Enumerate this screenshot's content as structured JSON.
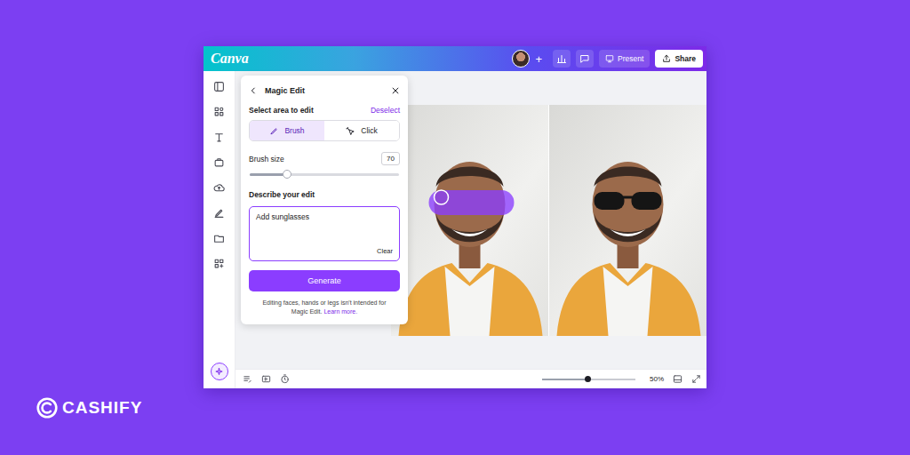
{
  "brand": {
    "name": "CASHIFY"
  },
  "app": {
    "logo": "Canva"
  },
  "toolbar": {
    "add": "+",
    "present": "Present",
    "share": "Share"
  },
  "magic_edit": {
    "title": "Magic Edit",
    "select_label": "Select area to edit",
    "deselect": "Deselect",
    "modes": [
      {
        "label": "Brush",
        "selected": true
      },
      {
        "label": "Click",
        "selected": false
      }
    ],
    "brush_size": {
      "label": "Brush size",
      "value": "70",
      "level": 0.25
    },
    "describe_label": "Describe your edit",
    "prompt": "Add sunglasses",
    "clear": "Clear",
    "generate": "Generate",
    "note": "Editing faces, hands or legs isn't intended for Magic Edit.",
    "learn_more": "Learn more."
  },
  "zoom": {
    "level": 0.49,
    "reading": "50%"
  }
}
